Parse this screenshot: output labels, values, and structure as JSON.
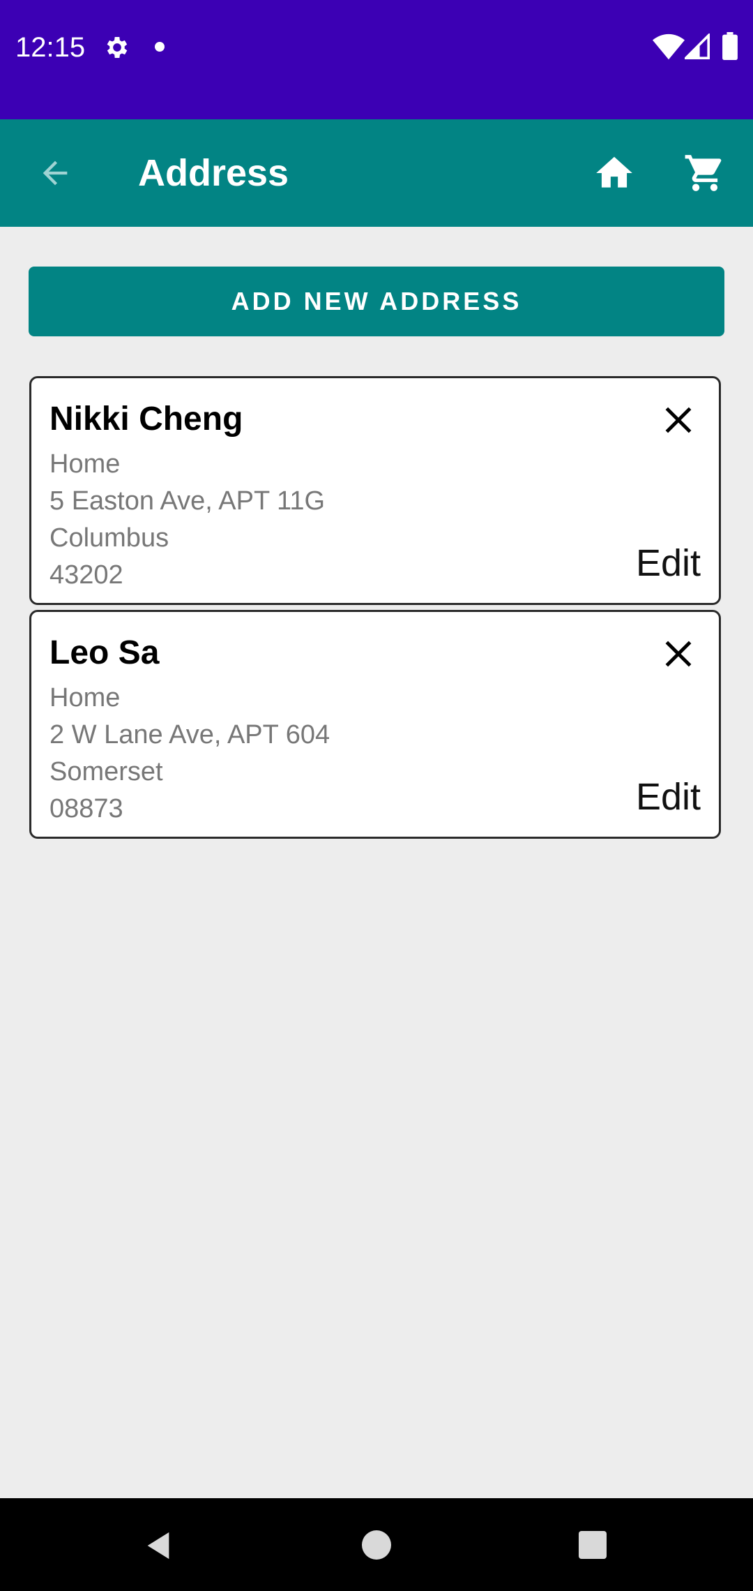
{
  "status_bar": {
    "time": "12:15",
    "icons": [
      "gear-icon",
      "notification-dot",
      "wifi-icon",
      "signal-icon",
      "battery-icon"
    ]
  },
  "app_bar": {
    "title": "Address",
    "back_icon": "arrow-back-icon",
    "actions": [
      "home-icon",
      "cart-icon"
    ],
    "background": "#028484"
  },
  "add_button": {
    "label": "ADD NEW ADDRESS"
  },
  "addresses": [
    {
      "name": "Nikki Cheng",
      "type": "Home",
      "street": "5 Easton Ave,",
      "unit": "APT 11G",
      "city": "Columbus",
      "zip": "43202",
      "edit_label": "Edit"
    },
    {
      "name": "Leo Sa",
      "type": "Home",
      "street": "2 W Lane Ave,",
      "unit": "APT 604",
      "city": "Somerset",
      "zip": "08873",
      "edit_label": "Edit"
    }
  ],
  "nav_bar": {
    "icons": [
      "back-triangle-icon",
      "home-circle-icon",
      "recents-square-icon"
    ]
  },
  "colors": {
    "status_bar": "#3c00b4",
    "accent": "#028484",
    "background": "#ededed"
  }
}
